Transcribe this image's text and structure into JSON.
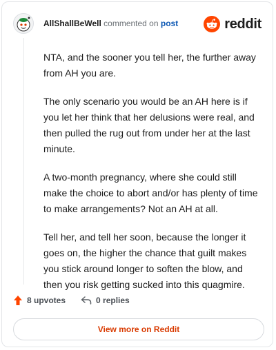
{
  "header": {
    "author": "AllShallBeWell",
    "action_text": "commented on",
    "post_link": "post",
    "brand": "reddit"
  },
  "comment": {
    "paragraphs": [
      "NTA, and the sooner you tell her, the further away from AH you are.",
      "The only scenario you would be an AH here is if you let her think that her delusions were real, and then pulled the rug out from under her at the last minute.",
      "A two-month pregnancy, where she could still make the choice to abort and/or has plenty of time to make arrangements? Not an AH at all.",
      "Tell her, and tell her soon, because the longer it goes on, the higher the chance that guilt makes you stick around longer to soften the blow, and then you risk getting sucked into this quagmire."
    ]
  },
  "actions": {
    "upvotes": "8 upvotes",
    "replies": "0 replies"
  },
  "footer": {
    "view_more": "View more on Reddit"
  },
  "colors": {
    "brand_orange": "#ff4500",
    "link_blue": "#0a56b3",
    "cta_red": "#d93a00"
  },
  "icons": {
    "avatar": "snoo-avatar",
    "brand": "reddit-logo-icon",
    "upvote": "upvote-arrow-icon",
    "reply": "reply-arrow-icon"
  }
}
